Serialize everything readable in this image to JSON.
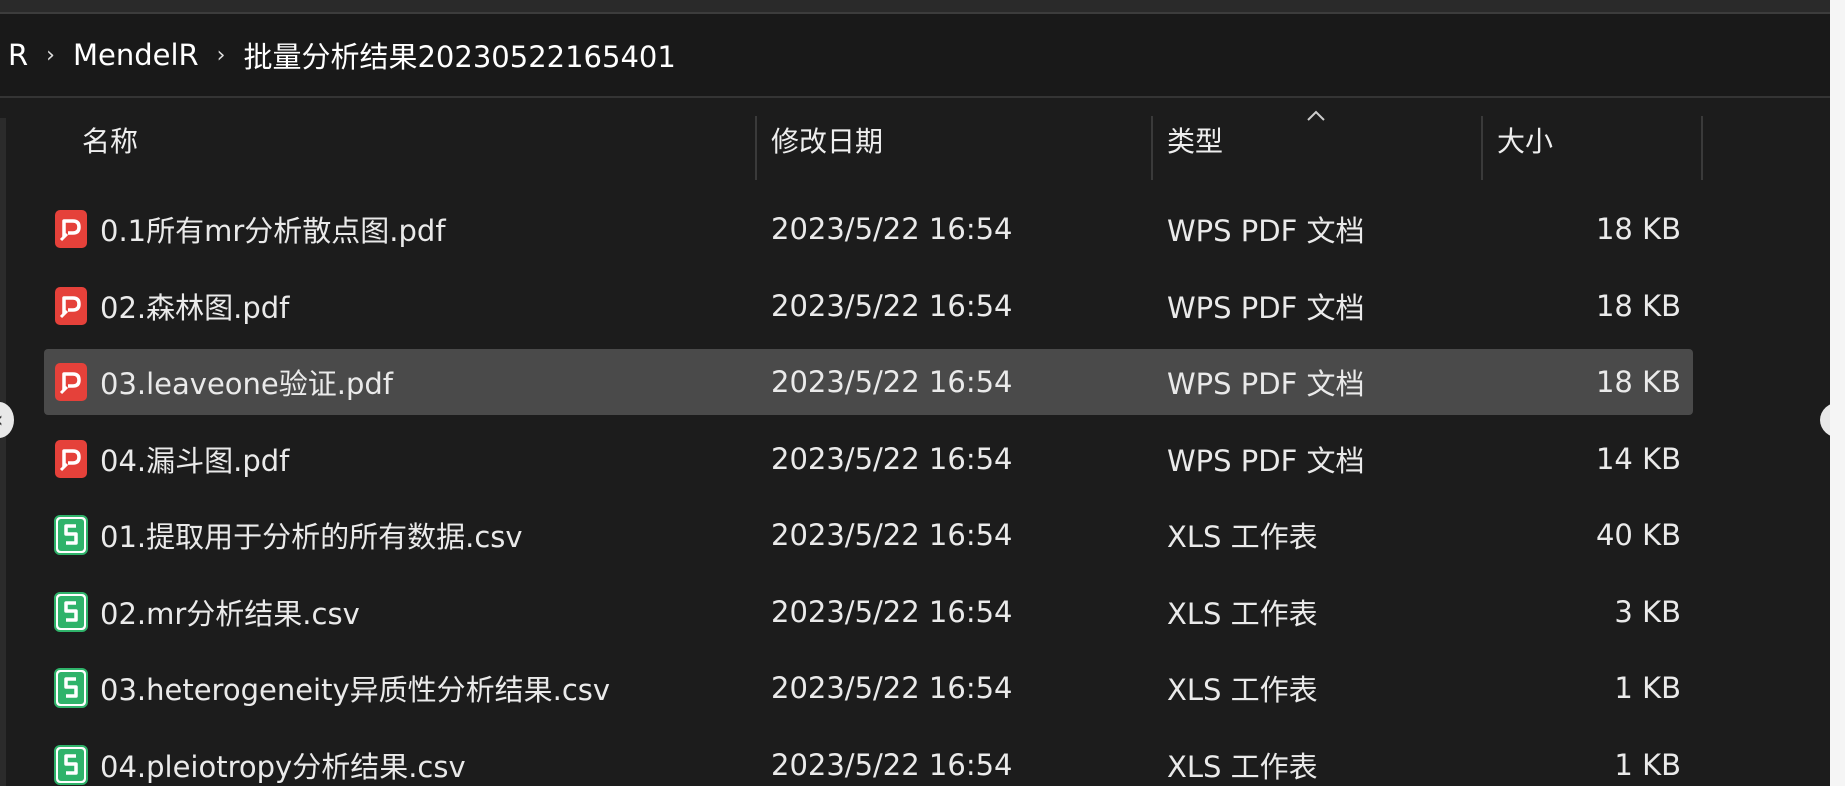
{
  "breadcrumb": {
    "items": [
      "R",
      "MendelR",
      "批量分析结果20230522165401"
    ],
    "separator": "›"
  },
  "columns": {
    "name": "名称",
    "modified": "修改日期",
    "type": "类型",
    "size": "大小"
  },
  "files": [
    {
      "name": "0.1所有mr分析散点图.pdf",
      "modified": "2023/5/22 16:54",
      "type": "WPS PDF 文档",
      "size": "18 KB",
      "icon": "wps-pdf-icon",
      "selected": false
    },
    {
      "name": "02.森林图.pdf",
      "modified": "2023/5/22 16:54",
      "type": "WPS PDF 文档",
      "size": "18 KB",
      "icon": "wps-pdf-icon",
      "selected": false
    },
    {
      "name": "03.leaveone验证.pdf",
      "modified": "2023/5/22 16:54",
      "type": "WPS PDF 文档",
      "size": "18 KB",
      "icon": "wps-pdf-icon",
      "selected": true
    },
    {
      "name": "04.漏斗图.pdf",
      "modified": "2023/5/22 16:54",
      "type": "WPS PDF 文档",
      "size": "14 KB",
      "icon": "wps-pdf-icon",
      "selected": false
    },
    {
      "name": "01.提取用于分析的所有数据.csv",
      "modified": "2023/5/22 16:54",
      "type": "XLS 工作表",
      "size": "40 KB",
      "icon": "wps-sheet-icon",
      "selected": false
    },
    {
      "name": "02.mr分析结果.csv",
      "modified": "2023/5/22 16:54",
      "type": "XLS 工作表",
      "size": "3 KB",
      "icon": "wps-sheet-icon",
      "selected": false
    },
    {
      "name": "03.heterogeneity异质性分析结果.csv",
      "modified": "2023/5/22 16:54",
      "type": "XLS 工作表",
      "size": "1 KB",
      "icon": "wps-sheet-icon",
      "selected": false
    },
    {
      "name": "04.pleiotropy分析结果.csv",
      "modified": "2023/5/22 16:54",
      "type": "XLS 工作表",
      "size": "1 KB",
      "icon": "wps-sheet-icon",
      "selected": false
    }
  ],
  "colors": {
    "background": "#1c1c1c",
    "selected_row": "#4a4a4a",
    "pdf_icon": "#e5413a",
    "sheet_icon": "#2fb36a"
  }
}
